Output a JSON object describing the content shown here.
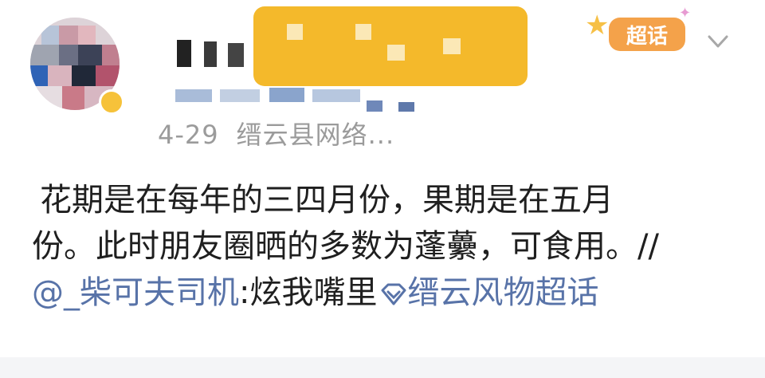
{
  "post": {
    "date": "4-29",
    "source": "缙云县网络...",
    "content_line1": "花期是在每年的三四月份，果期是在五月",
    "content_line2": "份。此时朋友圈晒的多数为蓬虆，可食用。//",
    "mention": "@_柴可夫司机",
    "repost_text": ":炫我嘴里",
    "topic": "缙云风物超话"
  },
  "badge": {
    "label": "超话"
  },
  "colors": {
    "link": "#5873a8",
    "meta": "#9b9b9b",
    "badge": "#f4a24a",
    "name_blur": "#f4b92b"
  },
  "icons": [
    "star-icon",
    "chevron-down-icon",
    "diamond-icon"
  ]
}
